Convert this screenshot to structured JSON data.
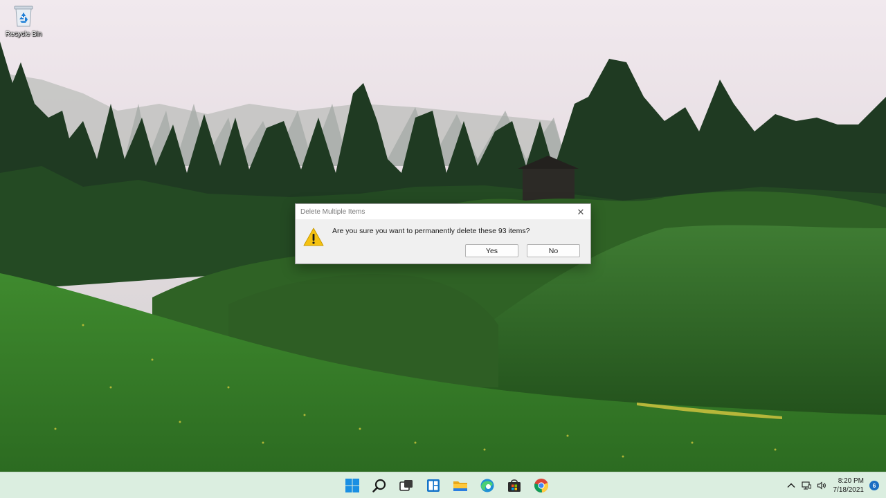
{
  "desktop": {
    "icons": [
      {
        "label": "Recycle Bin",
        "icon": "recycle-bin-icon"
      }
    ]
  },
  "dialog": {
    "title": "Delete Multiple Items",
    "message": "Are you sure you want to permanently delete these 93 items?",
    "icon": "warning-icon",
    "close_icon": "close-icon",
    "buttons": {
      "yes": "Yes",
      "no": "No"
    }
  },
  "taskbar": {
    "pinned": [
      {
        "name": "start",
        "icon": "windows-start-icon"
      },
      {
        "name": "search",
        "icon": "search-icon"
      },
      {
        "name": "task-view",
        "icon": "task-view-icon"
      },
      {
        "name": "widgets",
        "icon": "widgets-icon"
      },
      {
        "name": "file-explorer",
        "icon": "folder-icon"
      },
      {
        "name": "edge",
        "icon": "edge-icon"
      },
      {
        "name": "store",
        "icon": "store-icon"
      },
      {
        "name": "chrome",
        "icon": "chrome-icon"
      }
    ],
    "tray": {
      "icons": [
        "chevron-up-icon",
        "network-icon",
        "volume-icon"
      ],
      "time": "8:20 PM",
      "date": "7/18/2021",
      "notification_count": "6"
    }
  },
  "colors": {
    "taskbar_bg": "#dbeee0",
    "dialog_bg": "#f0f0f0",
    "accent": "#1b6ec2",
    "warning": "#f5c211"
  }
}
